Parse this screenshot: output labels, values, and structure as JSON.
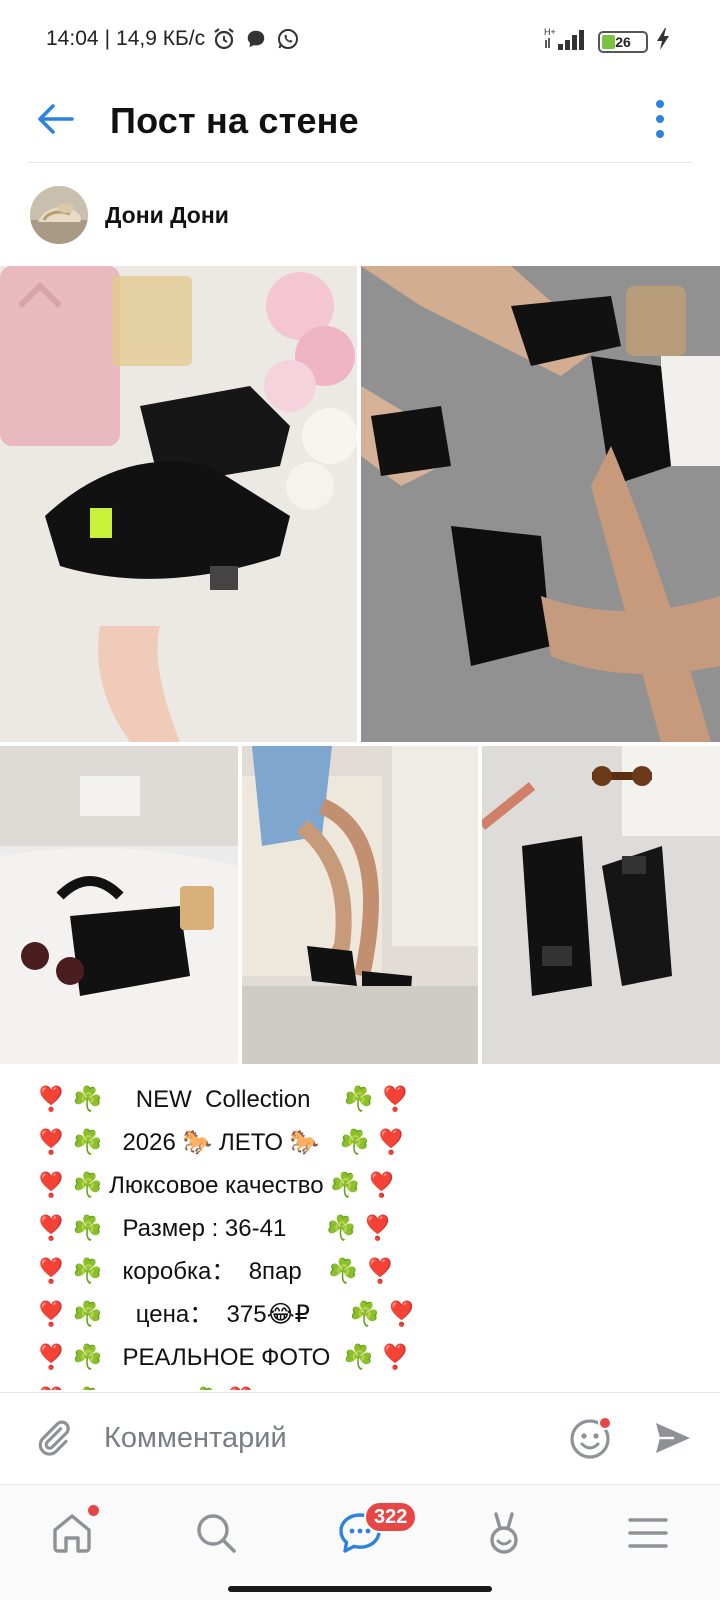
{
  "status_bar": {
    "time": "14:04",
    "separator": "|",
    "speed": "14,9 КБ/с",
    "network": "H+",
    "battery": "26"
  },
  "header": {
    "title": "Пост на стене"
  },
  "post": {
    "author_name": "Дони Дони",
    "lines": [
      {
        "left": "❣️ ☘️     ",
        "text": "NEW  Collection",
        "right": "     ☘️ ❣️"
      },
      {
        "left": "❣️ ☘️   ",
        "text": "2026 🐎 ЛЕТО 🐎",
        "right": "   ☘️ ❣️"
      },
      {
        "left": "❣️ ☘️ ",
        "text": "Люксовое качество",
        "right": " ☘️ ❣️"
      },
      {
        "left": "❣️ ☘️   ",
        "text": "Размер : 36-41",
        "right": "      ☘️ ❣️"
      },
      {
        "left": "❣️ ☘️   ",
        "text": "коробка：  8пар",
        "right": "    ☘️ ❣️"
      },
      {
        "left": "❣️ ☘️     ",
        "text": "цена：  375😂₽",
        "right": "      ☘️ ❣️"
      },
      {
        "left": "❣️ ☘️   ",
        "text": "РЕАЛЬНОЕ ФОТО",
        "right": "  ☘️ ❣️"
      },
      {
        "left": "❣️ ☘️   ",
        "text": "",
        "right": "          ☘️ ❣️"
      }
    ]
  },
  "comment_bar": {
    "placeholder": "Комментарий"
  },
  "bottom_nav": {
    "messages_badge": "322"
  },
  "icons": {
    "status": [
      "alarm-icon",
      "chat-bubble-icon",
      "whatsapp-icon",
      "signal-icon",
      "battery-icon",
      "charging-icon"
    ],
    "header": [
      "back-arrow-icon",
      "more-vertical-icon"
    ],
    "comment": [
      "paperclip-icon",
      "emoji-icon",
      "send-icon"
    ],
    "nav": [
      "home-icon",
      "search-icon",
      "messages-icon",
      "clips-icon",
      "menu-icon"
    ]
  },
  "colors": {
    "accent": "#2d81e0",
    "badge": "#e64646",
    "heart": "#e52b3a",
    "clover": "#3aa33a",
    "icon_gray": "#8e9297"
  }
}
